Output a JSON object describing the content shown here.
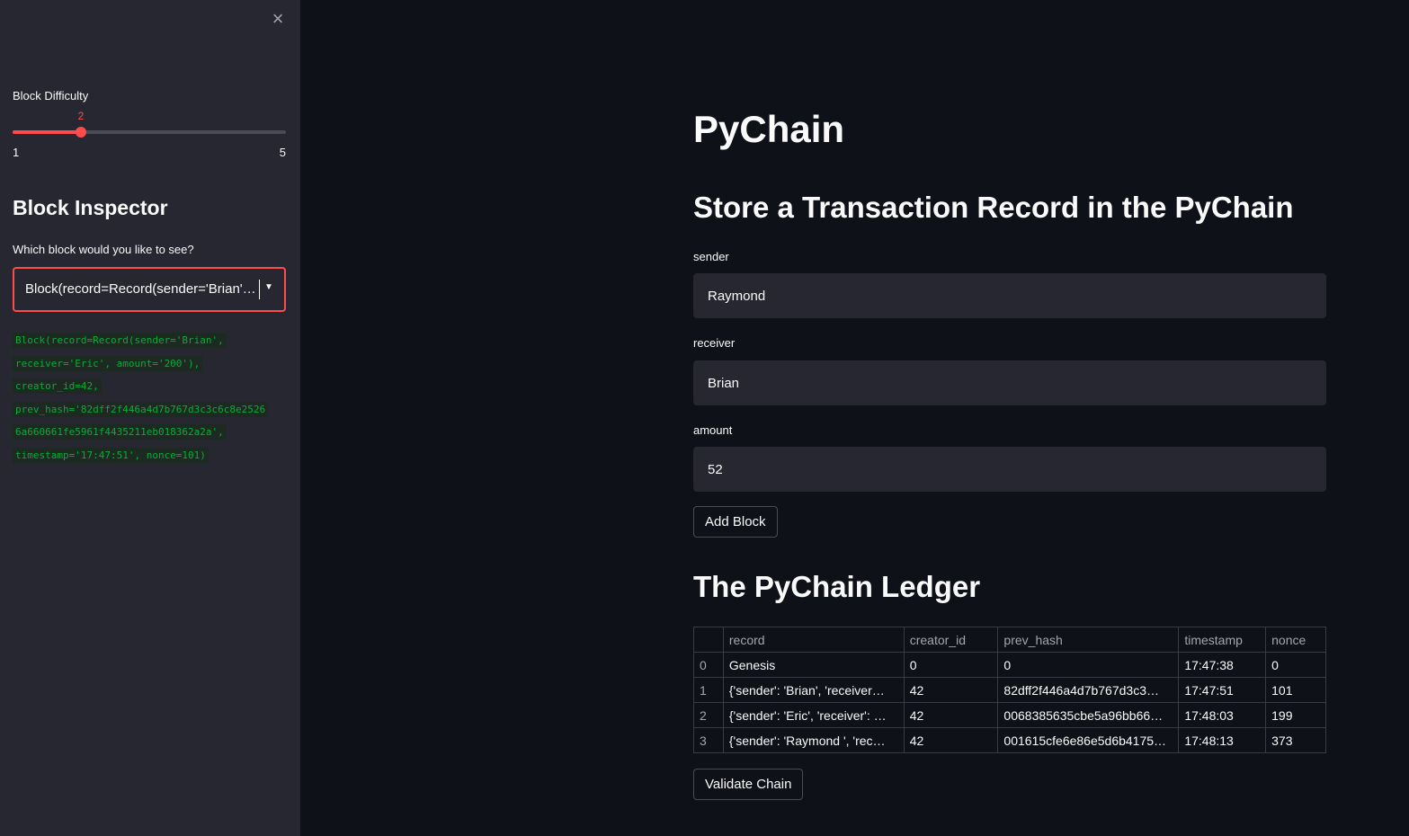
{
  "sidebar": {
    "close_icon": "×",
    "slider": {
      "label": "Block Difficulty",
      "value": "2",
      "min": "1",
      "max": "5",
      "fraction": 0.25
    },
    "inspector_title": "Block Inspector",
    "select_label": "Which block would you like to see?",
    "select_value": "Block(record=Record(sender='Brian', receiver='Eric', amount='200'), creator_id=42, prev_hash='82dff2f446a4d7b767d3c3c6c8e25266a660661fe5961f4435211eb018362a2a', timestamp='17:47:51', nonce=101)",
    "code_lines": [
      "Block(record=Record(sender='Brian',",
      "receiver='Eric', amount='200'),",
      "creator_id=42,",
      "prev_hash='82dff2f446a4d7b767d3c3c6c8e2526",
      "6a660661fe5961f4435211eb018362a2a',",
      "timestamp='17:47:51', nonce=101)"
    ]
  },
  "main": {
    "title": "PyChain",
    "store_heading": "Store a Transaction Record in the PyChain",
    "sender_label": "sender",
    "sender_value": "Raymond",
    "receiver_label": "receiver",
    "receiver_value": "Brian",
    "amount_label": "amount",
    "amount_value": "52",
    "add_block_label": "Add Block",
    "ledger_heading": "The PyChain Ledger",
    "validate_label": "Validate Chain"
  },
  "ledger": {
    "columns": [
      "",
      "record",
      "creator_id",
      "prev_hash",
      "timestamp",
      "nonce"
    ],
    "rows": [
      [
        "0",
        "Genesis",
        "0",
        "0",
        "17:47:38",
        "0"
      ],
      [
        "1",
        "{'sender': 'Brian', 'receiver…",
        "42",
        "82dff2f446a4d7b767d3c3…",
        "17:47:51",
        "101"
      ],
      [
        "2",
        "{'sender': 'Eric', 'receiver': …",
        "42",
        "0068385635cbe5a96bb66…",
        "17:48:03",
        "199"
      ],
      [
        "3",
        "{'sender': 'Raymond ', 'rec…",
        "42",
        "001615cfe6e86e5d6b4175…",
        "17:48:13",
        "373"
      ]
    ]
  },
  "colors": {
    "accent": "#ff4b4b",
    "code_green": "#09ab3b",
    "sidebar_bg": "#262730",
    "main_bg": "#0e1117"
  }
}
